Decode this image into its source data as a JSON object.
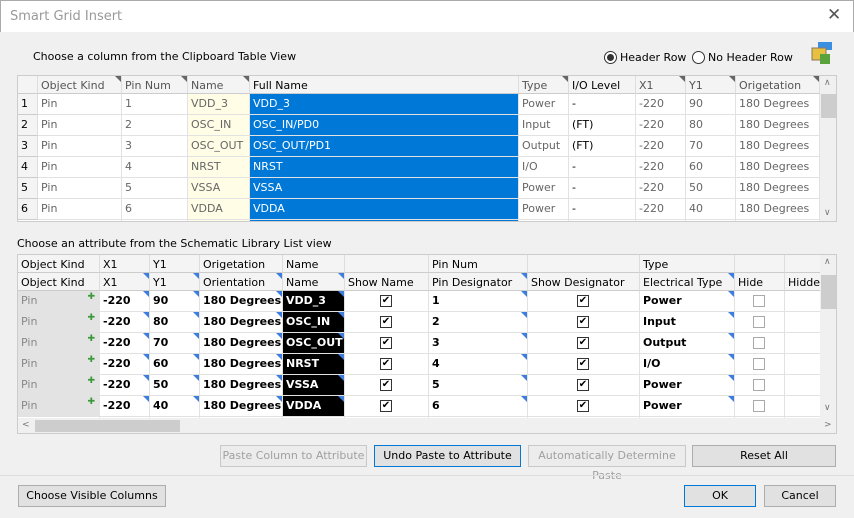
{
  "window": {
    "title": "Smart Grid Insert",
    "close_icon": "close-icon"
  },
  "clipboard": {
    "label": "Choose a column from the Clipboard Table View",
    "header_row": "Header Row",
    "no_header_row": "No Header Row",
    "header_row_selected": true,
    "columns": [
      "Object Kind",
      "Pin Num",
      "Name",
      "Full Name",
      "Type",
      "I/O Level",
      "X1",
      "Y1",
      "Origetation"
    ],
    "rows": [
      [
        "1",
        "Pin",
        "1",
        "VDD_3",
        "VDD_3",
        "Power",
        "-",
        "-220",
        "90",
        "180 Degrees"
      ],
      [
        "2",
        "Pin",
        "2",
        "OSC_IN",
        "OSC_IN/PD0",
        "Input",
        "(FT)",
        "-220",
        "80",
        "180 Degrees"
      ],
      [
        "3",
        "Pin",
        "3",
        "OSC_OUT",
        "OSC_OUT/PD1",
        "Output",
        "(FT)",
        "-220",
        "70",
        "180 Degrees"
      ],
      [
        "4",
        "Pin",
        "4",
        "NRST",
        "NRST",
        "I/O",
        "-",
        "-220",
        "60",
        "180 Degrees"
      ],
      [
        "5",
        "Pin",
        "5",
        "VSSA",
        "VSSA",
        "Power",
        "-",
        "-220",
        "50",
        "180 Degrees"
      ],
      [
        "6",
        "Pin",
        "6",
        "VDDA",
        "VDDA",
        "Power",
        "-",
        "-220",
        "40",
        "180 Degrees"
      ]
    ],
    "selected_column": "Full Name"
  },
  "library": {
    "label": "Choose an attribute from the Schematic Library List view",
    "mapped_headers": [
      "Object Kind",
      "X1",
      "Y1",
      "Origetation",
      "Name",
      "",
      "Pin Num",
      "",
      "Type",
      "",
      ""
    ],
    "columns": [
      "Object Kind",
      "X1",
      "Y1",
      "Orientation",
      "Name",
      "Show Name",
      "Pin Designator",
      "Show Designator",
      "Electrical Type",
      "Hide",
      "Hidden"
    ],
    "rows": [
      [
        "Pin",
        "-220",
        "90",
        "180 Degrees",
        "VDD_3",
        true,
        "1",
        true,
        "Power",
        false
      ],
      [
        "Pin",
        "-220",
        "80",
        "180 Degrees",
        "OSC_IN",
        true,
        "2",
        true,
        "Input",
        false
      ],
      [
        "Pin",
        "-220",
        "70",
        "180 Degrees",
        "OSC_OUT",
        true,
        "3",
        true,
        "Output",
        false
      ],
      [
        "Pin",
        "-220",
        "60",
        "180 Degrees",
        "NRST",
        true,
        "4",
        true,
        "I/O",
        false
      ],
      [
        "Pin",
        "-220",
        "50",
        "180 Degrees",
        "VSSA",
        true,
        "5",
        true,
        "Power",
        false
      ],
      [
        "Pin",
        "-220",
        "40",
        "180 Degrees",
        "VDDA",
        true,
        "6",
        true,
        "Power",
        false
      ]
    ]
  },
  "actions": {
    "paste_column": "Paste Column to Attribute",
    "undo_paste": "Undo Paste to Attribute",
    "auto_determine": "Automatically Determine Paste",
    "reset_all": "Reset All"
  },
  "footer": {
    "choose_columns": "Choose Visible Columns",
    "ok": "OK",
    "cancel": "Cancel"
  }
}
